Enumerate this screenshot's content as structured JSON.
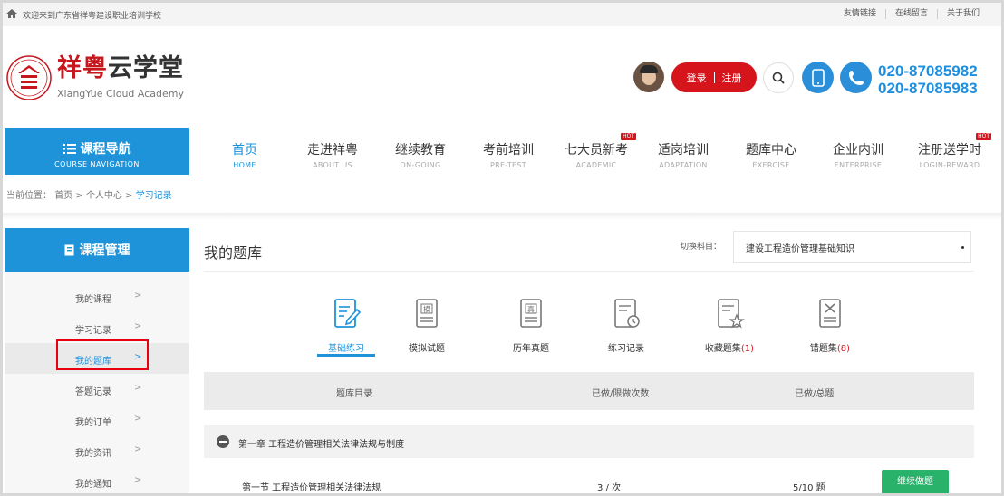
{
  "topbar": {
    "welcome": "欢迎来到广东省祥粤建设职业培训学校",
    "links": [
      "友情链接",
      "在线留言",
      "关于我们"
    ]
  },
  "header": {
    "brand_red": "祥粤",
    "brand_dark": "云学堂",
    "brand_en": "XiangYue Cloud Academy",
    "login": "登录",
    "register": "注册",
    "phones": [
      "020-87085982",
      "020-87085983"
    ]
  },
  "course_nav": {
    "title": "课程导航",
    "subtitle": "COURSE NAVIGATION"
  },
  "nav": [
    {
      "cn": "首页",
      "en": "HOME",
      "active": true
    },
    {
      "cn": "走进祥粤",
      "en": "ABOUT US"
    },
    {
      "cn": "继续教育",
      "en": "ON-GOING"
    },
    {
      "cn": "考前培训",
      "en": "PRE-TEST"
    },
    {
      "cn": "七大员新考",
      "en": "ACADEMIC",
      "badge": "HOT"
    },
    {
      "cn": "适岗培训",
      "en": "ADAPTATION"
    },
    {
      "cn": "题库中心",
      "en": "EXERCISE"
    },
    {
      "cn": "企业内训",
      "en": "ENTERPRISE"
    },
    {
      "cn": "注册送学时",
      "en": "LOGIN-REWARD",
      "badge": "HOT"
    }
  ],
  "breadcrumb": {
    "prefix": "当前位置：",
    "home": "首页",
    "mid": "个人中心",
    "current": "学习记录"
  },
  "sidebar": {
    "title": "课程管理",
    "items": [
      {
        "label": "我的课程"
      },
      {
        "label": "学习记录"
      },
      {
        "label": "我的题库",
        "active": true
      },
      {
        "label": "答题记录"
      },
      {
        "label": "我的订单"
      },
      {
        "label": "我的资讯"
      },
      {
        "label": "我的通知"
      }
    ]
  },
  "main": {
    "title": "我的题库",
    "subject_label": "切换科目：",
    "subject_value": "建设工程造价管理基础知识",
    "tabs": [
      {
        "label": "基础练习",
        "icon": "pencil-doc-icon",
        "active": true
      },
      {
        "label": "模拟试题",
        "icon": "mock-doc-icon",
        "glyph": "模"
      },
      {
        "label": "历年真题",
        "icon": "real-doc-icon",
        "glyph": "真"
      },
      {
        "label": "练习记录",
        "icon": "clock-doc-icon"
      },
      {
        "label": "收藏题集",
        "count": "(1)",
        "icon": "star-doc-icon"
      },
      {
        "label": "错题集",
        "count": "(8)",
        "icon": "x-doc-icon"
      }
    ],
    "table": {
      "headers": [
        "题库目录",
        "已做/限做次数",
        "已做/总题"
      ],
      "chapter": "第一章 工程造价管理相关法律法规与制度",
      "rows": [
        {
          "name": "第一节 工程造价管理相关法律法规",
          "attempts": "3 /  次",
          "progress": "5/10 题",
          "action": "继续做题"
        }
      ]
    }
  },
  "colors": {
    "primary": "#1f93d9",
    "red": "#d5141c",
    "green": "#29b26a"
  }
}
